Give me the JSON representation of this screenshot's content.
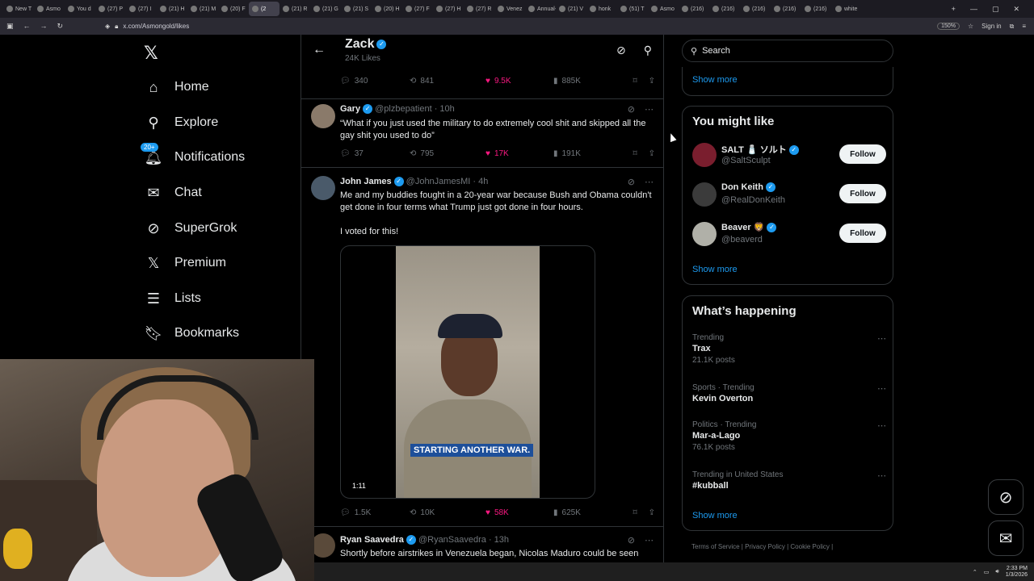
{
  "browser": {
    "tabs": [
      "New T",
      "Asmo",
      "You d",
      "(27) P",
      "(27) I",
      "(21) H",
      "(21) M",
      "(20) F",
      "(2",
      "(21) R",
      "(21) G",
      "(21) S",
      "(20) H",
      "(27) F",
      "(27) H",
      "(27) R",
      "Venez",
      "Annual-1",
      "(21) V",
      "honk",
      "(51) T",
      "Asmo",
      "(216)",
      "(216)",
      "(216)",
      "(216)",
      "(216)",
      "white"
    ],
    "active_tab_index": 8,
    "url": "x.com/Asmongold/likes",
    "zoom": "150%",
    "signin": "Sign in"
  },
  "nav": {
    "items": [
      {
        "label": "Home",
        "icon": "home-icon"
      },
      {
        "label": "Explore",
        "icon": "search-icon"
      },
      {
        "label": "Notifications",
        "icon": "bell-icon"
      },
      {
        "label": "Chat",
        "icon": "mail-icon"
      },
      {
        "label": "SuperGrok",
        "icon": "grok-icon"
      },
      {
        "label": "Premium",
        "icon": "x-logo-icon"
      },
      {
        "label": "Lists",
        "icon": "list-icon"
      },
      {
        "label": "Bookmarks",
        "icon": "bookmark-icon"
      }
    ],
    "notif_badge": "20+"
  },
  "header": {
    "name": "Zack",
    "sub": "24K Likes"
  },
  "tweets": [
    {
      "stats": {
        "replies": "340",
        "retweets": "841",
        "likes": "9.5K",
        "views": "885K"
      }
    },
    {
      "name": "Gary",
      "handle": "@plzbepatient",
      "time": "· 10h",
      "text": "“What if you just used the military to do extremely cool shit and skipped all the gay shit you used to do”",
      "stats": {
        "replies": "37",
        "retweets": "795",
        "likes": "17K",
        "views": "191K"
      }
    },
    {
      "name": "John James",
      "handle": "@JohnJamesMI",
      "time": "· 4h",
      "text": "Me and my buddies fought in a 20-year war because Bush and Obama couldn't get done in four terms what Trump just got done in four hours.",
      "text2": "I voted for this!",
      "video_caption": "STARTING ANOTHER WAR.",
      "duration": "1:11",
      "stats": {
        "replies": "1.5K",
        "retweets": "10K",
        "likes": "58K",
        "views": "625K"
      }
    },
    {
      "name": "Ryan Saavedra",
      "handle": "@RyanSaavedra",
      "time": "· 13h",
      "text": "Shortly before airstrikes in Venezuela began, Nicolas Maduro could be seen"
    }
  ],
  "right": {
    "search_placeholder": "Search",
    "show_more": "Show more",
    "might_like_title": "You might like",
    "suggestions": [
      {
        "name": "SALT 🧂 ソルト",
        "handle": "@SaltSculpt",
        "color": "#7a1e2e"
      },
      {
        "name": "Don Keith",
        "handle": "@RealDonKeith",
        "color": "#3b3b3b"
      },
      {
        "name": "Beaver 🦁",
        "handle": "@beaverd",
        "color": "#b0b0a8"
      }
    ],
    "follow_label": "Follow",
    "happening_title": "What’s happening",
    "trends": [
      {
        "cat": "Trending",
        "title": "Trax",
        "posts": "21.1K posts"
      },
      {
        "cat": "Sports · Trending",
        "title": "Kevin Overton",
        "posts": ""
      },
      {
        "cat": "Politics · Trending",
        "title": "Mar-a-Lago",
        "posts": "76.1K posts"
      },
      {
        "cat": "Trending in United States",
        "title": "#kubball",
        "posts": ""
      }
    ],
    "footer": "Terms of Service  |  Privacy Policy  |  Cookie Policy  |"
  },
  "taskbar": {
    "time": "2:33 PM",
    "date": "1/3/2026"
  }
}
